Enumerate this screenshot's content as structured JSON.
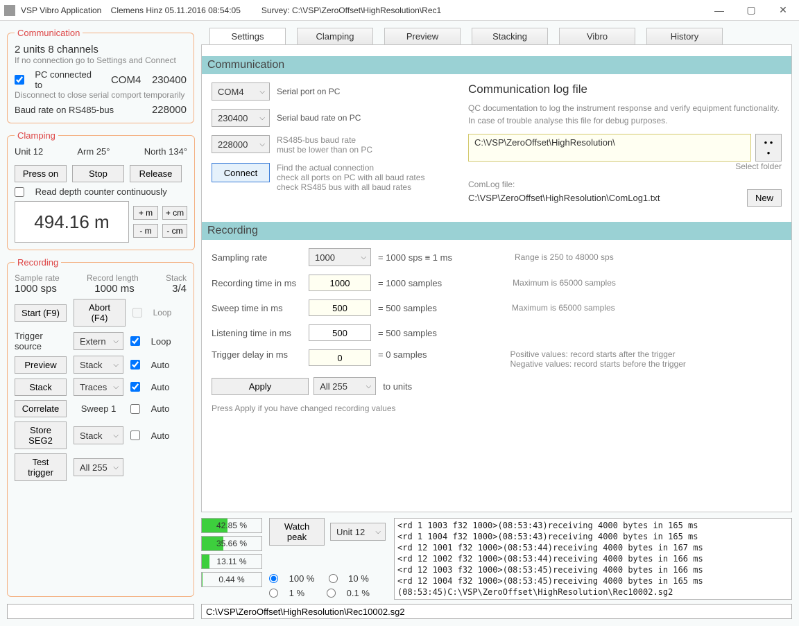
{
  "title": {
    "app": "VSP Vibro Application",
    "userstamp": "Clemens Hinz 05.11.2016 08:54:05",
    "survey_label": "Survey:",
    "survey_path": "C:\\VSP\\ZeroOffset\\HighResolution\\Rec1"
  },
  "comm": {
    "legend": "Communication",
    "line1": "2 units   8 channels",
    "hint1": "If no connection go to Settings and Connect",
    "pc_connected_label": "PC connected to",
    "port": "COM4",
    "baud_pc": "230400",
    "hint2": "Disconnect to close serial comport temporarily",
    "rs485_label": "Baud rate on RS485-bus",
    "rs485_baud": "228000"
  },
  "clamp": {
    "legend": "Clamping",
    "unit": "Unit 12",
    "arm": "Arm 25°",
    "north": "North 134°",
    "press": "Press on",
    "stop": "Stop",
    "release": "Release",
    "read_depth": "Read depth counter continuously",
    "depth": "494.16 m",
    "plus_m": "+ m",
    "plus_cm": "+ cm",
    "minus_m": "- m",
    "minus_cm": "- cm"
  },
  "rec_left": {
    "legend": "Recording",
    "sr_lbl": "Sample rate",
    "len_lbl": "Record length",
    "stack_lbl": "Stack",
    "sr": "1000 sps",
    "len": "1000 ms",
    "stack": "3/4",
    "start": "Start  (F9)",
    "abort": "Abort  (F4)",
    "loop": "Loop",
    "trigsrc": "Trigger source",
    "extern": "Extern",
    "preview": "Preview",
    "stackb": "Stack",
    "auto": "Auto",
    "traces": "Traces",
    "correlate": "Correlate",
    "sweep1": "Sweep 1",
    "storeseg2": "Store SEG2",
    "testtrigger": "Test trigger",
    "all255": "All 255"
  },
  "tabs": [
    "Settings",
    "Clamping",
    "Preview",
    "Stacking",
    "Vibro",
    "History"
  ],
  "settings": {
    "comm_hdr": "Communication",
    "com_port": "COM4",
    "com_port_lbl": "Serial port on PC",
    "pc_baud": "230400",
    "pc_baud_lbl": "Serial baud rate on PC",
    "rs485_baud": "228000",
    "rs485_baud_lbl1": "RS485-bus baud rate",
    "rs485_baud_lbl2": "must be lower than on PC",
    "connect": "Connect",
    "connect_lbl1": "Find the actual connection",
    "connect_lbl2": "check all ports on PC with all baud rates",
    "connect_lbl3": "check RS485 bus with all baud rates",
    "logfile_hdr": "Communication log file",
    "logfile_desc": "QC documentation to log the instrument response and verify equipment functionality. In case of trouble analyse this file for debug purposes.",
    "folder_path": "C:\\VSP\\ZeroOffset\\HighResolution\\",
    "select_folder": "Select folder",
    "dots": "• • •",
    "comlog_lbl": "ComLog file:",
    "comlog_path": "C:\\VSP\\ZeroOffset\\HighResolution\\ComLog1.txt",
    "new": "New",
    "rec_hdr": "Recording",
    "sampling_rate": "Sampling rate",
    "sampling_sel": "1000",
    "sampling_eq": "= 1000 sps   ≡  1 ms",
    "sampling_range": "Range is 250 to 48000 sps",
    "rec_time": "Recording time in ms",
    "rec_val": "1000",
    "rec_eq": "= 1000 samples",
    "rec_max": "Maximum is 65000 samples",
    "sweep_time": "Sweep time in ms",
    "sweep_val": "500",
    "sweep_eq": "= 500 samples",
    "sweep_max": "Maximum is 65000 samples",
    "listen_time": "Listening time in ms",
    "listen_val": "500",
    "listen_eq": "= 500 samples",
    "trig_delay": "Trigger delay in ms",
    "trig_val": "0",
    "trig_eq": "= 0 samples",
    "trig_hint1": "Positive values: record starts after the trigger",
    "trig_hint2": "Negative values: record starts before the trigger",
    "apply": "Apply",
    "tounits_sel": "All 255",
    "tounits_lbl": "to units",
    "apply_hint": "Press Apply if you have changed recording values"
  },
  "bottom": {
    "bars": [
      {
        "pct": "42.85 %",
        "fill": 42.85
      },
      {
        "pct": "35.66 %",
        "fill": 35.66
      },
      {
        "pct": "13.11 %",
        "fill": 13.11
      },
      {
        "pct": "0.44 %",
        "fill": 0.44
      }
    ],
    "watch_peak": "Watch peak",
    "unit_sel": "Unit 12",
    "radio_100": "100 %",
    "radio_10": "10 %",
    "radio_1": "1 %",
    "radio_01": "0.1 %",
    "log_lines": [
      "<rd 1 1003 f32 1000>(08:53:43)receiving 4000 bytes in 165 ms",
      "<rd 1 1004 f32 1000>(08:53:43)receiving 4000 bytes in 165 ms",
      "<rd 12 1001 f32 1000>(08:53:44)receiving 4000 bytes in 167 ms",
      "<rd 12 1002 f32 1000>(08:53:44)receiving 4000 bytes in 166 ms",
      "<rd 12 1003 f32 1000>(08:53:45)receiving 4000 bytes in 166 ms",
      "<rd 12 1004 f32 1000>(08:53:45)receiving 4000 bytes in 165 ms",
      "(08:53:45)C:\\VSP\\ZeroOffset\\HighResolution\\Rec10002.sg2"
    ],
    "footer_path": "C:\\VSP\\ZeroOffset\\HighResolution\\Rec10002.sg2"
  }
}
